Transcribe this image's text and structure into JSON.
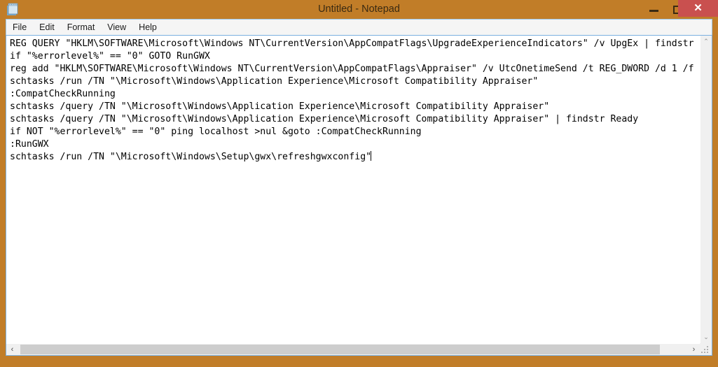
{
  "window": {
    "title": "Untitled - Notepad",
    "icon": "notepad-icon",
    "frame_color": "#c17d28",
    "close_button_color": "#c9504f"
  },
  "titlebar": {
    "minimize_label": "—",
    "maximize_label": "□",
    "close_label": "✕"
  },
  "menubar": {
    "items": [
      {
        "label": "File"
      },
      {
        "label": "Edit"
      },
      {
        "label": "Format"
      },
      {
        "label": "View"
      },
      {
        "label": "Help"
      }
    ]
  },
  "editor": {
    "lines": [
      "REG QUERY \"HKLM\\SOFTWARE\\Microsoft\\Windows NT\\CurrentVersion\\AppCompatFlags\\UpgradeExperienceIndicators\" /v UpgEx | findstr",
      "if \"%errorlevel%\" == \"0\" GOTO RunGWX",
      "reg add \"HKLM\\SOFTWARE\\Microsoft\\Windows NT\\CurrentVersion\\AppCompatFlags\\Appraiser\" /v UtcOnetimeSend /t REG_DWORD /d 1 /f",
      "schtasks /run /TN \"\\Microsoft\\Windows\\Application Experience\\Microsoft Compatibility Appraiser\"",
      ":CompatCheckRunning",
      "schtasks /query /TN \"\\Microsoft\\Windows\\Application Experience\\Microsoft Compatibility Appraiser\"",
      "schtasks /query /TN \"\\Microsoft\\Windows\\Application Experience\\Microsoft Compatibility Appraiser\" | findstr Ready",
      "if NOT \"%errorlevel%\" == \"0\" ping localhost >nul &goto :CompatCheckRunning",
      ":RunGWX",
      "schtasks /run /TN \"\\Microsoft\\Windows\\Setup\\gwx\\refreshgwxconfig\""
    ],
    "text": "REG QUERY \"HKLM\\SOFTWARE\\Microsoft\\Windows NT\\CurrentVersion\\AppCompatFlags\\UpgradeExperienceIndicators\" /v UpgEx | findstr\nif \"%errorlevel%\" == \"0\" GOTO RunGWX\nreg add \"HKLM\\SOFTWARE\\Microsoft\\Windows NT\\CurrentVersion\\AppCompatFlags\\Appraiser\" /v UtcOnetimeSend /t REG_DWORD /d 1 /f\nschtasks /run /TN \"\\Microsoft\\Windows\\Application Experience\\Microsoft Compatibility Appraiser\"\n:CompatCheckRunning\nschtasks /query /TN \"\\Microsoft\\Windows\\Application Experience\\Microsoft Compatibility Appraiser\"\nschtasks /query /TN \"\\Microsoft\\Windows\\Application Experience\\Microsoft Compatibility Appraiser\" | findstr Ready\nif NOT \"%errorlevel%\" == \"0\" ping localhost >nul &goto :CompatCheckRunning\n:RunGWX\nschtasks /run /TN \"\\Microsoft\\Windows\\Setup\\gwx\\refreshgwxconfig\"",
    "caret_line": 10,
    "caret_after": "refreshgwxconfig\"",
    "background_color": "#ffffff",
    "text_color": "#000000"
  },
  "scrollbars": {
    "vertical": {
      "up_label": "⌃",
      "down_label": "⌄"
    },
    "horizontal": {
      "left_label": "‹",
      "right_label": "›"
    }
  }
}
